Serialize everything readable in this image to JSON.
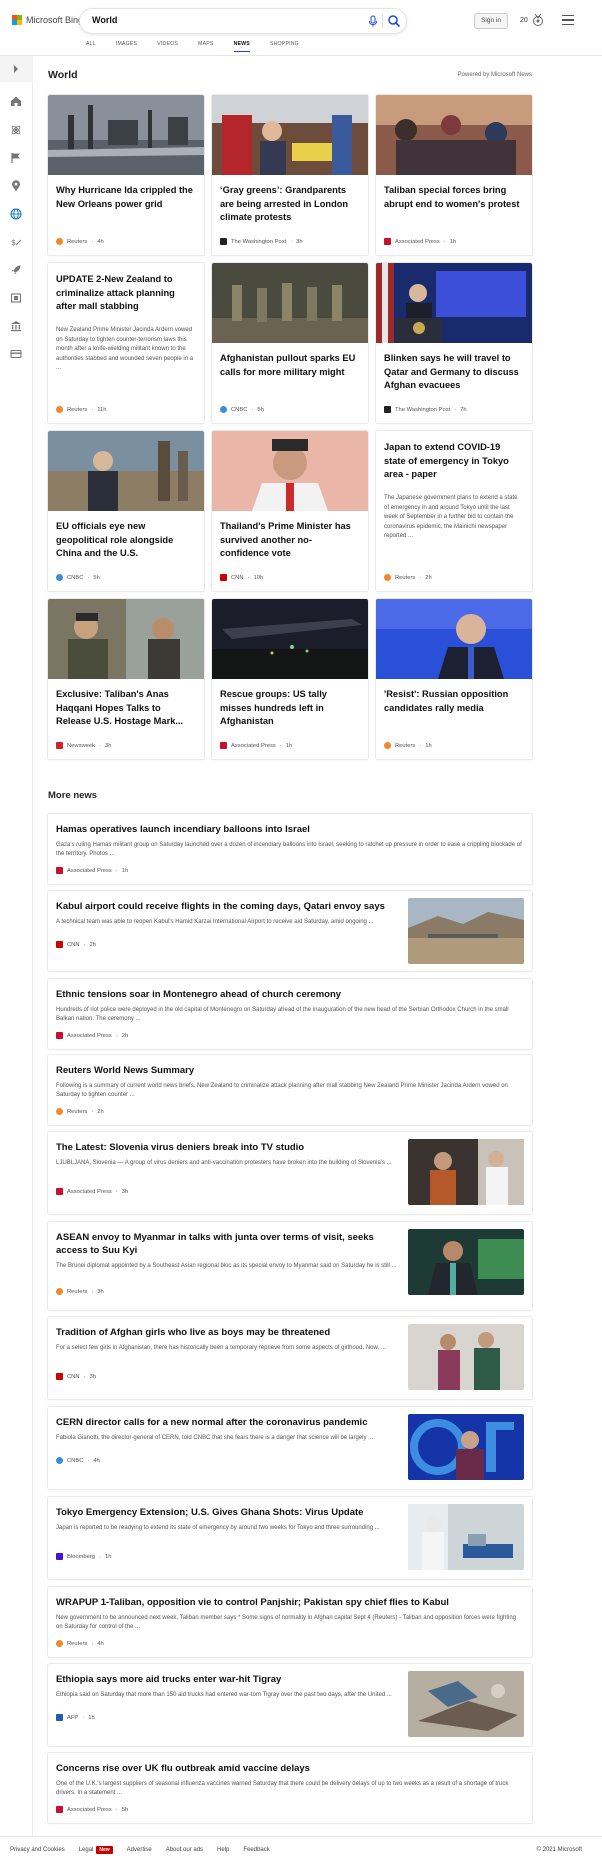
{
  "header": {
    "brand": "Microsoft Bing",
    "search_value": "World",
    "signin_label": "Sign in",
    "rewards_count": "20",
    "tabs": [
      "ALL",
      "IMAGES",
      "VIDEOS",
      "MAPS",
      "NEWS",
      "SHOPPING"
    ],
    "active_tab": "NEWS"
  },
  "section": {
    "title": "World",
    "powered_by": "Powered by Microsoft News"
  },
  "cards": [
    {
      "title": "Why Hurricane Ida crippled the New Orleans power grid",
      "source": "Reuters",
      "time": "4h",
      "src_color": "#f0892b"
    },
    {
      "title": "‘Gray greens’: Grandparents are being arrested in London climate protests",
      "source": "The Washington Post",
      "time": "3h",
      "src_color": "#222222"
    },
    {
      "title": "Taliban special forces bring abrupt end to women's protest",
      "source": "Associated Press",
      "time": "1h",
      "src_color": "#c8102e"
    },
    {
      "title": "UPDATE 2-New Zealand to criminalize attack planning after mall stabbing",
      "snippet": "New Zealand Prime Minister Jacinda Ardern vowed on Saturday to tighten counter-terrorism laws this month after a knife-wielding militant known to the authorities stabbed and wounded seven people in a ...",
      "source": "Reuters",
      "time": "11h",
      "src_color": "#f0892b"
    },
    {
      "title": "Afghanistan pullout sparks EU calls for more military might",
      "source": "CNBC",
      "time": "5h",
      "src_color": "#3a8ed8"
    },
    {
      "title": "Blinken says he will travel to Qatar and Germany to discuss Afghan evacuees",
      "source": "The Washington Post",
      "time": "7h",
      "src_color": "#222222"
    },
    {
      "title": "EU officials eye new geopolitical role alongside China and the U.S.",
      "source": "CNBC",
      "time": "5h",
      "src_color": "#3a8ed8"
    },
    {
      "title": "Thailand's Prime Minister has survived another no-confidence vote",
      "source": "CNN",
      "time": "10h",
      "src_color": "#cc0000"
    },
    {
      "title": "Japan to extend COVID-19 state of emergency in Tokyo area - paper",
      "snippet": "The Japanese government plans to extend a state of emergency in and around Tokyo until the last week of September in a further bid to contain the coronavirus epidemic, the Mainichi newspaper reported ...",
      "source": "Reuters",
      "time": "2h",
      "src_color": "#f0892b"
    },
    {
      "title": "Exclusive: Taliban's Anas Haqqani Hopes Talks to Release U.S. Hostage Mark...",
      "source": "Newsweek",
      "time": "3h",
      "src_color": "#d61f26"
    },
    {
      "title": "Rescue groups: US tally misses hundreds left in Afghanistan",
      "source": "Associated Press",
      "time": "1h",
      "src_color": "#c8102e"
    },
    {
      "title": "'Resist': Russian opposition candidates rally media",
      "source": "Reuters",
      "time": "1h",
      "src_color": "#f0892b"
    }
  ],
  "more_news": {
    "title": "More news",
    "items": [
      {
        "title": "Hamas operatives launch incendiary balloons into Israel",
        "snippet": "Gaza's ruling Hamas militant group on Saturday launched over a dozen of incendiary balloons into Israel, seeking to ratchet up pressure in order to ease a crippling blockade of the territory. Photos ...",
        "source": "Associated Press",
        "time": "1h",
        "src_color": "#c8102e"
      },
      {
        "title": "Kabul airport could receive flights in the coming days, Qatari envoy says",
        "snippet": "A technical team was able to reopen Kabul's Hamid Karzai International Airport to receive aid Saturday, amid ongoing ...",
        "source": "CNN",
        "time": "2h",
        "src_color": "#cc0000"
      },
      {
        "title": "Ethnic tensions soar in Montenegro ahead of church ceremony",
        "snippet": "Hundreds of riot police were deployed in the old capital of Montenegro on Saturday ahead of the inauguration of the new head of the Serbian Orthodox Church in the small Balkan nation. The ceremony ...",
        "source": "Associated Press",
        "time": "2h",
        "src_color": "#c8102e"
      },
      {
        "title": "Reuters World News Summary",
        "snippet": "Following is a summary of current world news briefs. New Zealand to criminalize attack planning after mall stabbing New Zealand Prime Minister Jacinda Ardern vowed on Saturday to tighten counter ...",
        "source": "Reuters",
        "time": "2h",
        "src_color": "#f0892b"
      },
      {
        "title": "The Latest: Slovenia virus deniers break into TV studio",
        "snippet": "LJUBLJANA, Slovenia — A group of virus deniers and anti-vaccination protesters have broken into the building of Slovenia's ...",
        "source": "Associated Press",
        "time": "3h",
        "src_color": "#c8102e"
      },
      {
        "title": "ASEAN envoy to Myanmar in talks with junta over terms of visit, seeks access to Suu Kyi",
        "snippet": "The Brunei diplomat appointed by a Southeast Asian regional bloc as its special envoy to Myanmar said on Saturday he is still ...",
        "source": "Reuters",
        "time": "3h",
        "src_color": "#f0892b"
      },
      {
        "title": "Tradition of Afghan girls who live as boys may be threatened",
        "snippet": "For a select few girls in Afghanistan, there has historically been a temporary reprieve from some aspects of girlhood. Now, ...",
        "source": "CNN",
        "time": "3h",
        "src_color": "#cc0000"
      },
      {
        "title": "CERN director calls for a new normal after the coronavirus pandemic",
        "snippet": "Fabiola Gianotti, the director-general of CERN, told CNBC that she fears there is a danger that science will be largely ...",
        "source": "CNBC",
        "time": "4h",
        "src_color": "#3a8ed8"
      },
      {
        "title": "Tokyo Emergency Extension; U.S. Gives Ghana Shots: Virus Update",
        "snippet": "Japan is reported to be readying to extend its state of emergency by around two weeks for Tokyo and three surrounding ...",
        "source": "Bloomberg",
        "time": "1h",
        "src_color": "#4b0fd1"
      },
      {
        "title": "WRAPUP 1-Taliban, opposition vie to control Panjshir; Pakistan spy chief flies to Kabul",
        "snippet": "New government to be announced next week, Taliban member says * Some signs of normality in Afghan capital Sept 4 (Reuters) - Taliban and opposition forces were fighting on Saturday for control of the ...",
        "source": "Reuters",
        "time": "4h",
        "src_color": "#f0892b"
      },
      {
        "title": "Ethiopia says more aid trucks enter war-hit Tigray",
        "snippet": "Ethiopia said on Saturday that more than 150 aid trucks had entered war-torn Tigray over the past two days, after the United ...",
        "source": "AFP",
        "time": "1h",
        "src_color": "#1e5bb8"
      },
      {
        "title": "Concerns rise over UK flu outbreak amid vaccine delays",
        "snippet": "One of the U.K.'s largest suppliers of seasonal influenza vaccines warned Saturday that there could be delivery delays of up to two weeks as a result of a shortage of truck drivers. In a statement ...",
        "source": "Associated Press",
        "time": "5h",
        "src_color": "#c8102e"
      }
    ]
  },
  "footer": {
    "links": [
      "Privacy and Cookies",
      "Legal",
      "Advertise",
      "About our ads",
      "Help",
      "Feedback"
    ],
    "new_badge": "New",
    "copyright": "© 2021 Microsoft"
  },
  "colors": {
    "accent": "#174ae4",
    "rail_active": "#0f7cc0"
  }
}
